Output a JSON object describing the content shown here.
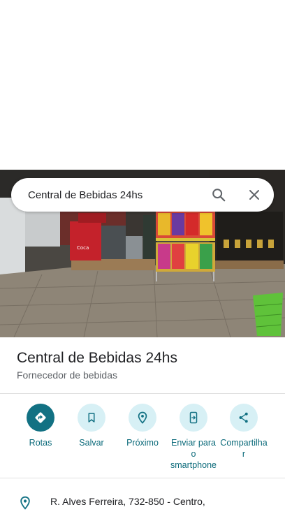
{
  "search": {
    "query": "Central de Bebidas 24hs"
  },
  "place": {
    "name": "Central de Bebidas 24hs",
    "category": "Fornecedor de bebidas",
    "address": "R. Alves Ferreira, 732-850 - Centro,"
  },
  "actions": [
    {
      "label": "Rotas",
      "icon": "directions-icon"
    },
    {
      "label": "Salvar",
      "icon": "bookmark-icon"
    },
    {
      "label": "Próximo",
      "icon": "nearby-icon"
    },
    {
      "label": "Enviar para o smartphone",
      "label_lines": [
        "Enviar para",
        "o",
        "smartphone"
      ],
      "icon": "send-to-phone-icon"
    },
    {
      "label": "Compartilhar",
      "label_lines": [
        "Compartilha",
        "r"
      ],
      "icon": "share-icon"
    }
  ],
  "colors": {
    "accent": "#127183",
    "accent_light": "#d7f0f5",
    "text_primary": "#202124",
    "text_secondary": "#5f6368"
  }
}
